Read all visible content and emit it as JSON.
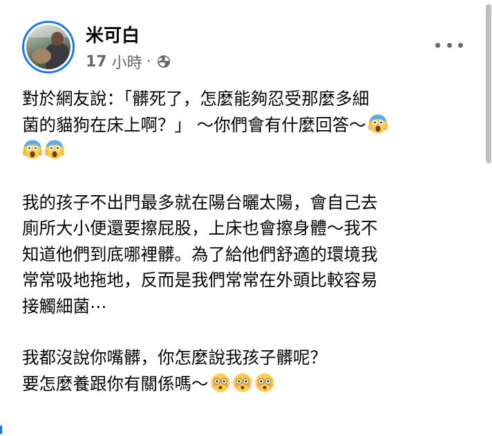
{
  "post": {
    "author": {
      "name": "米可白",
      "avatar_icon": "profile-photo",
      "avatar_ring_color": "#1877f2"
    },
    "meta": {
      "time_value": "17",
      "time_unit": "小時",
      "separator": "·",
      "audience_icon": "globe-icon"
    },
    "menu_icon": "more-options-icon",
    "paragraphs": [
      {
        "lines": [
          {
            "text": "對於網友說：「髒死了，怎麼能夠忍受那麼多細"
          },
          {
            "text": "菌的貓狗在床上啊？」 ～你們會有什麼回答～",
            "emoji_after": [
              "screaming-face"
            ]
          },
          {
            "text": "",
            "emoji_after": [
              "screaming-face",
              "screaming-face"
            ]
          }
        ]
      },
      {
        "lines": [
          {
            "text": "我的孩子不出門最多就在陽台曬太陽，會自己去"
          },
          {
            "text": "廁所大小便還要擦屁股，上床也會擦身體～我不"
          },
          {
            "text": "知道他們到底哪裡髒。為了給他們舒適的環境我"
          },
          {
            "text": "常常吸地拖地，反而是我們常常在外頭比較容易"
          },
          {
            "text": "接觸細菌⋯"
          }
        ]
      },
      {
        "lines": [
          {
            "text": "我都沒說你嘴髒，你怎麼說我孩子髒呢？"
          },
          {
            "text": "要怎麼養跟你有關係嗎～",
            "emoji_after": [
              "flushed-face",
              "flushed-face",
              "flushed-face"
            ]
          }
        ]
      }
    ]
  },
  "colors": {
    "text": "#050505",
    "secondary_text": "#65676b",
    "accent": "#1877f2",
    "scrollbar": "#bcc0c4",
    "emoji_yellow": "#ffcc4d"
  }
}
